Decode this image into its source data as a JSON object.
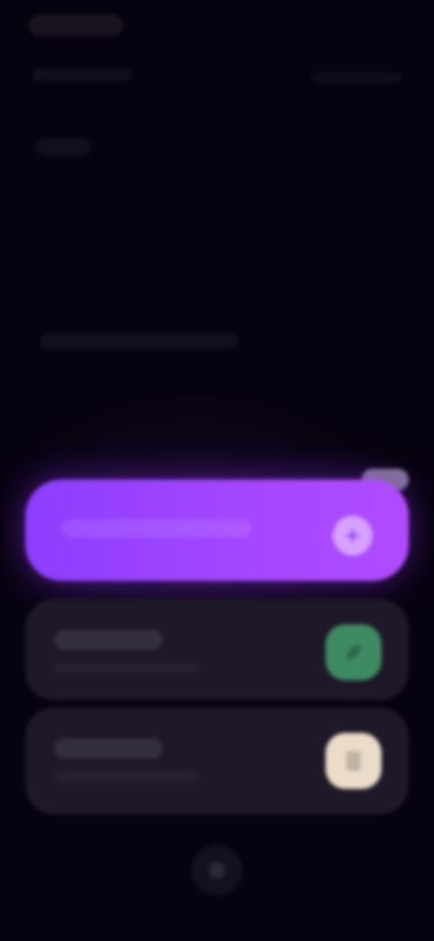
{
  "status_bar": {
    "time": ""
  },
  "header": {
    "left": "",
    "right": ""
  },
  "page": {
    "title": "",
    "section_label": ""
  },
  "cards": {
    "primary": {
      "label": "",
      "icon": "plus-icon",
      "accent": "#a547ff"
    },
    "rows": [
      {
        "title": "",
        "subtitle": "",
        "icon": "leaf-icon",
        "icon_color": "#3e8a63"
      },
      {
        "title": "",
        "subtitle": "",
        "icon": "document-icon",
        "icon_color": "#eadcc9"
      }
    ]
  },
  "nav": {
    "home_icon": "home-button-icon"
  },
  "colors": {
    "background": "#07020f",
    "card": "#1e1828",
    "accent": "#a547ff"
  }
}
